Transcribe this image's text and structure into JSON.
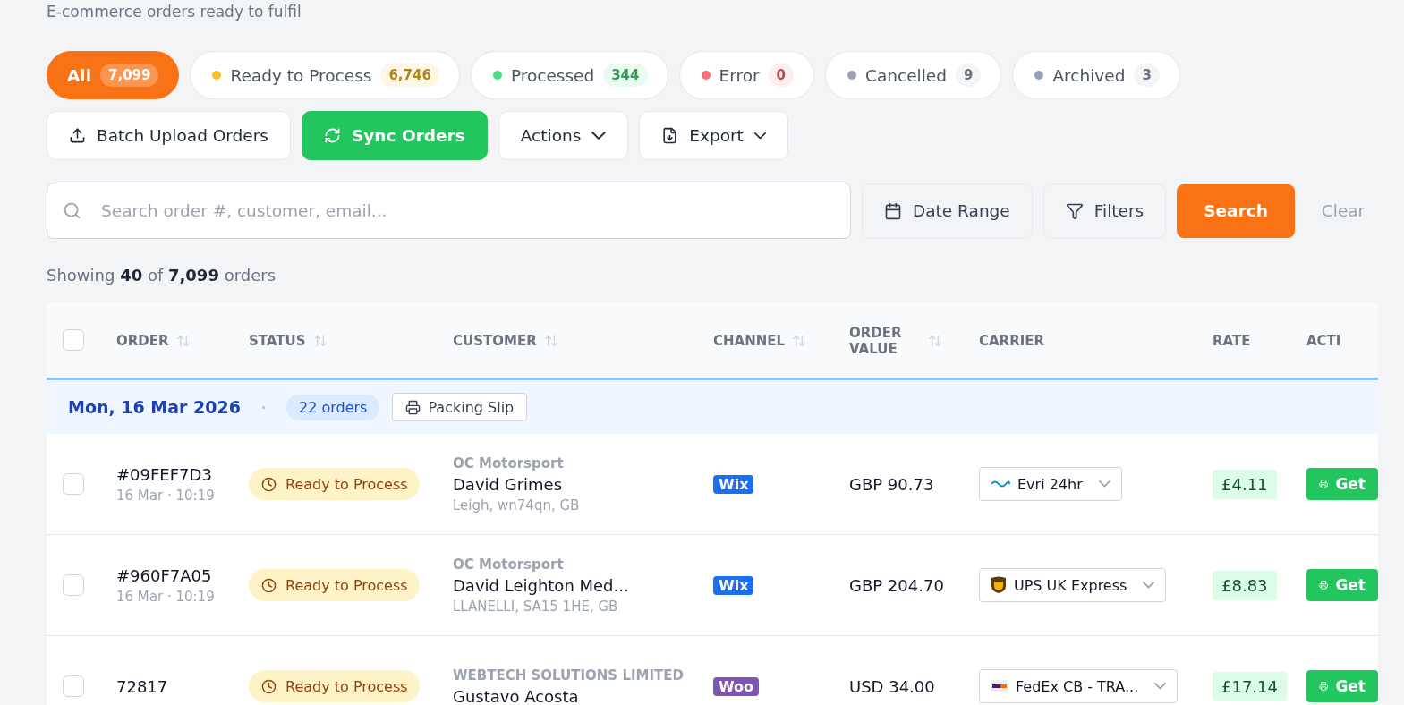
{
  "subtitle": "E-commerce orders ready to fulfil",
  "status_tabs": [
    {
      "label": "All",
      "count": "7,099",
      "selected": true
    },
    {
      "label": "Ready to Process",
      "count": "6,746",
      "color": "#fbbf24",
      "selected": false
    },
    {
      "label": "Processed",
      "count": "344",
      "color": "#4ade80",
      "selected": false
    },
    {
      "label": "Error",
      "count": "0",
      "color": "#f87171",
      "selected": false
    },
    {
      "label": "Cancelled",
      "count": "9",
      "color": "#9ca3af",
      "selected": false
    },
    {
      "label": "Archived",
      "count": "3",
      "color": "#94a3b8",
      "selected": false
    }
  ],
  "toolbar": [
    {
      "label": "Batch Upload Orders",
      "kind": "upload"
    },
    {
      "label": "Sync Orders",
      "kind": "sync"
    },
    {
      "label": "Actions",
      "kind": "menu"
    },
    {
      "label": "Export",
      "kind": "export"
    }
  ],
  "search": {
    "placeholder": "Search order #, customer, email..."
  },
  "filters": [
    {
      "label": "Date Range",
      "kind": "date"
    },
    {
      "label": "Filters",
      "kind": "filter"
    }
  ],
  "search_button": "Search",
  "clear_link": "Clear",
  "summary": "Showing **40** of **7,099** orders",
  "table": {
    "select_all_checked": false,
    "columns": [
      {
        "label": "ORDER",
        "sortable": true
      },
      {
        "label": "STATUS",
        "sortable": true
      },
      {
        "label": "CUSTOMER",
        "sortable": true
      },
      {
        "label": "CHANNEL",
        "sortable": true
      },
      {
        "label": "ORDER VALUE",
        "sortable": true
      },
      {
        "label": "CARRIER",
        "sortable": false
      },
      {
        "label": "RATE",
        "sortable": false
      },
      {
        "label": "ACTI",
        "sortable": false
      }
    ],
    "group": {
      "date": "Mon, 16 Mar 2026",
      "count": "22 orders",
      "button": "Packing Slip"
    },
    "rows": [
      {
        "checked": false,
        "order": "#09FEF7D3",
        "time": "16 Mar · 10:19",
        "status": "Ready to Process",
        "company": "OC Motorsport",
        "name": "David Grimes",
        "address": "Leigh, wn74qn, GB",
        "channel": {
          "label": "Wix",
          "color": "#1d6ff2"
        },
        "value": "GBP 90.73",
        "carrier": {
          "name": "Evri 24hr",
          "kind": "evri"
        },
        "rate": "£4.11",
        "action": "Get"
      },
      {
        "checked": false,
        "order": "#960F7A05",
        "time": "16 Mar · 10:19",
        "status": "Ready to Process",
        "company": "OC Motorsport",
        "name": "David Leighton Med...",
        "address": "LLANELLI, SA15 1HE, GB",
        "channel": {
          "label": "Wix",
          "color": "#1d6ff2"
        },
        "value": "GBP 204.70",
        "carrier": {
          "name": "UPS UK Express",
          "kind": "ups"
        },
        "rate": "£8.83",
        "action": "Get"
      },
      {
        "checked": false,
        "order": "72817",
        "status": "Ready to Process",
        "company": "WEBTECH SOLUTIONS LIMITED",
        "name": "Gustavo Acosta",
        "channel": {
          "label": "Woo",
          "color": "#7f54b3"
        },
        "value": "USD 34.00",
        "carrier": {
          "name": "FedEx CB - TRA...",
          "kind": "fedex"
        },
        "rate": "£17.14",
        "action": "Get"
      }
    ]
  }
}
